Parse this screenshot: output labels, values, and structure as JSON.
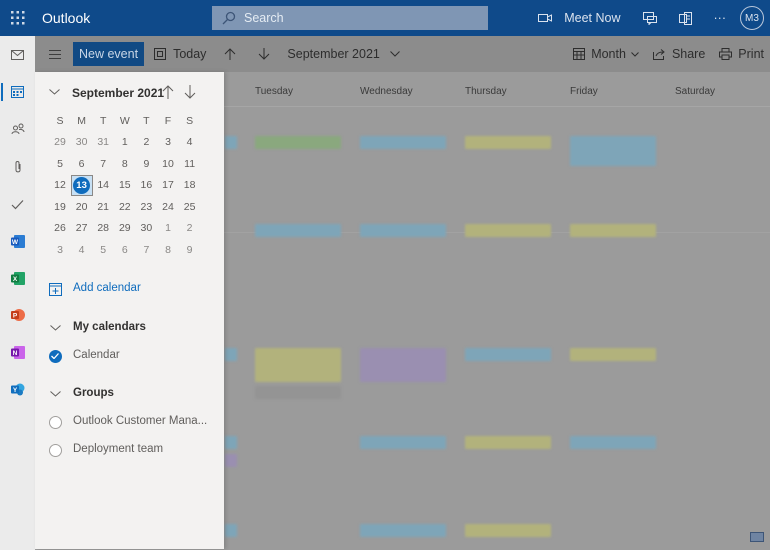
{
  "app": {
    "title": "Outlook"
  },
  "search": {
    "placeholder": "Search"
  },
  "topbar": {
    "meet_now": "Meet Now",
    "more": "···",
    "avatar_initials": "M3"
  },
  "commandbar": {
    "new_event": "New event",
    "today": "Today",
    "month_label": "September 2021",
    "view": "Month",
    "share": "Share",
    "print": "Print"
  },
  "calendar": {
    "day_headers": [
      "Tuesday",
      "Wednesday",
      "Thursday",
      "Friday",
      "Saturday"
    ]
  },
  "mini_calendar": {
    "title": "September 2021",
    "weekdays": [
      "S",
      "M",
      "T",
      "W",
      "T",
      "F",
      "S"
    ],
    "weeks": [
      [
        "29",
        "30",
        "31",
        "1",
        "2",
        "3",
        "4"
      ],
      [
        "5",
        "6",
        "7",
        "8",
        "9",
        "10",
        "11"
      ],
      [
        "12",
        "13",
        "14",
        "15",
        "16",
        "17",
        "18"
      ],
      [
        "19",
        "20",
        "21",
        "22",
        "23",
        "24",
        "25"
      ],
      [
        "26",
        "27",
        "28",
        "29",
        "30",
        "1",
        "2"
      ],
      [
        "3",
        "4",
        "5",
        "6",
        "7",
        "8",
        "9"
      ]
    ],
    "selected": "13"
  },
  "panel": {
    "add_calendar": "Add calendar",
    "my_calendars": "My calendars",
    "calendars": [
      {
        "label": "Calendar",
        "checked": true
      }
    ],
    "groups_header": "Groups",
    "groups": [
      {
        "label": "Outlook Customer Mana...",
        "checked": false
      },
      {
        "label": "Deployment team",
        "checked": false
      }
    ]
  },
  "colors": {
    "brand": "#0f4a8a",
    "accent": "#0f6cbd"
  }
}
